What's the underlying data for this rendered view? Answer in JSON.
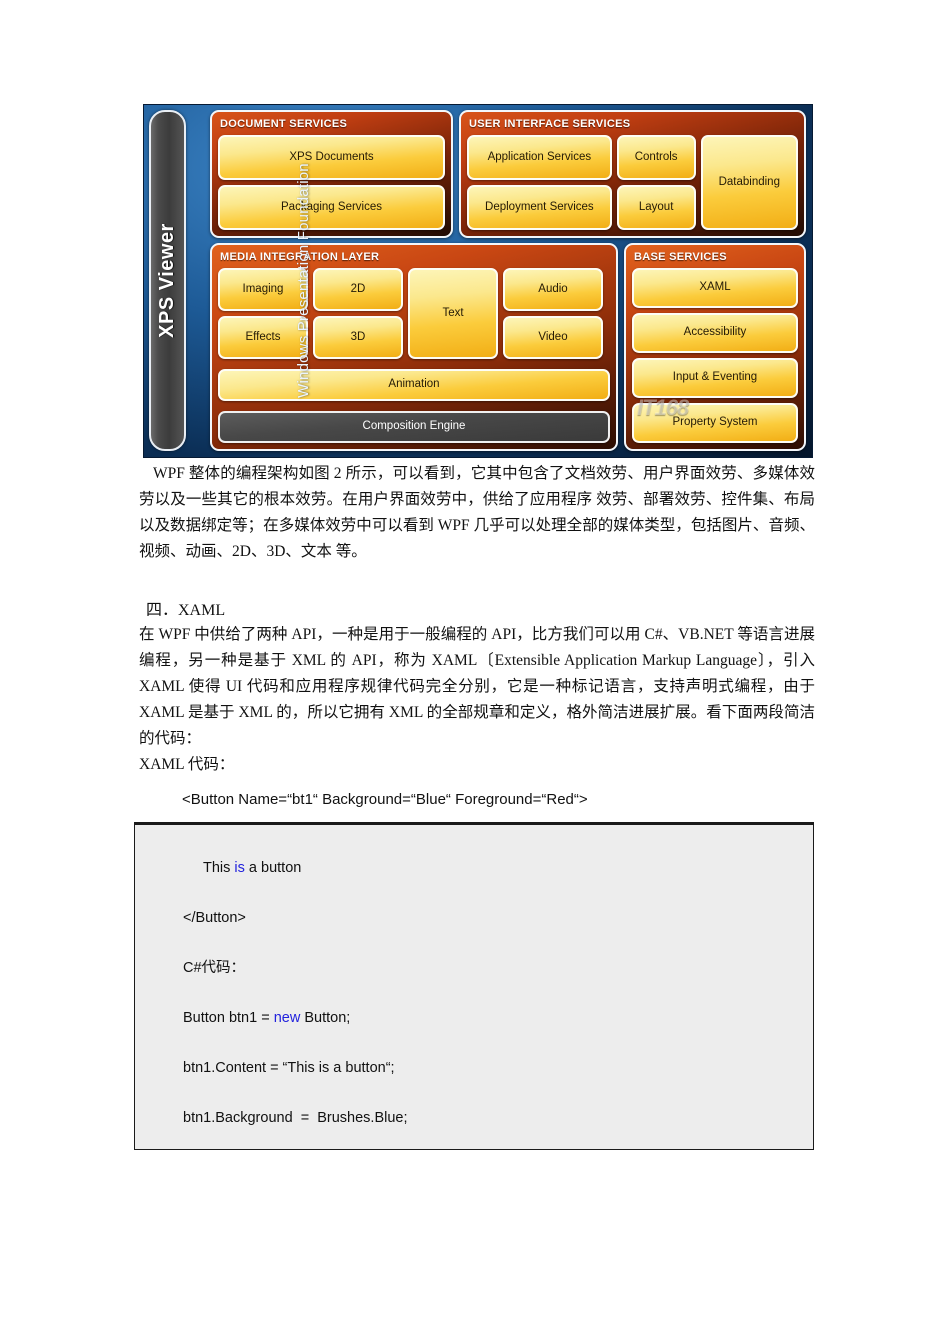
{
  "diagram": {
    "alt_name": "wpf-architecture-diagram",
    "sidebar": {
      "viewer_label": "XPS Viewer",
      "platform_label": "Windows Presentation Foundation"
    },
    "watermark": "IT168",
    "panels": [
      {
        "id": "document-services",
        "title": "DOCUMENT SERVICES",
        "tiles": [
          "XPS Documents",
          "Packaging Services"
        ]
      },
      {
        "id": "user-interface-services",
        "title": "USER INTERFACE SERVICES",
        "tiles": [
          "Application Services",
          "Deployment Services",
          "Controls",
          "Layout",
          "Databinding"
        ]
      },
      {
        "id": "media-integration-layer",
        "title": "MEDIA INTEGRATION LAYER",
        "tiles": [
          "Imaging",
          "Effects",
          "2D",
          "3D",
          "Text",
          "Audio",
          "Video",
          "Animation",
          "Composition Engine"
        ]
      },
      {
        "id": "base-services",
        "title": "BASE SERVICES",
        "tiles": [
          "XAML",
          "Accessibility",
          "Input & Eventing",
          "Property System"
        ]
      }
    ],
    "tiles": {
      "xps_documents": "XPS Documents",
      "packaging_services": "Packaging Services",
      "application_services": "Application Services",
      "deployment_services": "Deployment Services",
      "controls": "Controls",
      "layout": "Layout",
      "databinding": "Databinding",
      "imaging": "Imaging",
      "effects": "Effects",
      "two_d": "2D",
      "three_d": "3D",
      "text": "Text",
      "audio": "Audio",
      "video": "Video",
      "animation": "Animation",
      "composition_engine": "Composition Engine",
      "xaml": "XAML",
      "accessibility": "Accessibility",
      "input_eventing": "Input & Eventing",
      "property_system": "Property System"
    },
    "titles": {
      "document_services": "DOCUMENT SERVICES",
      "user_interface_services": "USER INTERFACE SERVICES",
      "media_integration_layer": "MEDIA INTEGRATION LAYER",
      "base_services": "BASE SERVICES"
    }
  },
  "body": {
    "paragraph_1": "WPF 整体的编程架构如图 2 所示，可以看到，它其中包含了文档效劳、用户界面效劳、多媒体效劳以及一些其它的根本效劳。在用户界面效劳中，供给了应用程序 效劳、部署效劳、控件集、布局以及数据绑定等；在多媒体效劳中可以看到 WPF 几乎可以处理全部的媒体类型，包括图片、音频、视频、动画、2D、3D、文本 等。",
    "heading_xaml": "四．XAML",
    "paragraph_2": "在 WPF 中供给了两种 API，一种是用于一般编程的 API，比方我们可以用 C#、VB.NET 等语言进展编程，另一种是基于 XML 的 API，称为 XAML〔Extensible Application Markup Language〕，引入 XAML 使得 UI 代码和应用程序规律代码完全分别，它是一种标记语言，支持声明式编程，由于 XAML 是基于 XML 的，所以它拥有 XML 的全部规章和定义，格外简洁进展扩展。看下面两段简洁的代码：",
    "paragraph_3": "XAML 代码：",
    "xaml_tag_line": "<Button Name=“bt1“ Background=“Blue“ Foreground=“Red“>"
  },
  "code_block": {
    "lines": [
      {
        "indent": true,
        "parts": [
          {
            "t": "This ",
            "kw": false
          },
          {
            "t": "is",
            "kw": true
          },
          {
            "t": " a button",
            "kw": false
          }
        ]
      },
      {
        "indent": false,
        "parts": [
          {
            "t": "</Button>",
            "kw": false
          }
        ]
      },
      {
        "indent": false,
        "parts": [
          {
            "t": "C#代码：",
            "kw": false
          }
        ]
      },
      {
        "indent": false,
        "parts": [
          {
            "t": "Button btn1 = ",
            "kw": false
          },
          {
            "t": "new",
            "kw": true
          },
          {
            "t": " Button;",
            "kw": false
          }
        ]
      },
      {
        "indent": false,
        "parts": [
          {
            "t": "btn1.Content = “This is a button“;",
            "kw": false
          }
        ]
      },
      {
        "indent": false,
        "parts": [
          {
            "t": "btn1.Background  =  Brushes.Blue;",
            "kw": false
          }
        ]
      }
    ]
  },
  "colors": {
    "diagram_blue": "#1d5a96",
    "panel_orange": "#c94713",
    "tile_yellow": "#fbcc3c",
    "code_bg": "#ededed",
    "keyword_blue": "#2222dd"
  }
}
